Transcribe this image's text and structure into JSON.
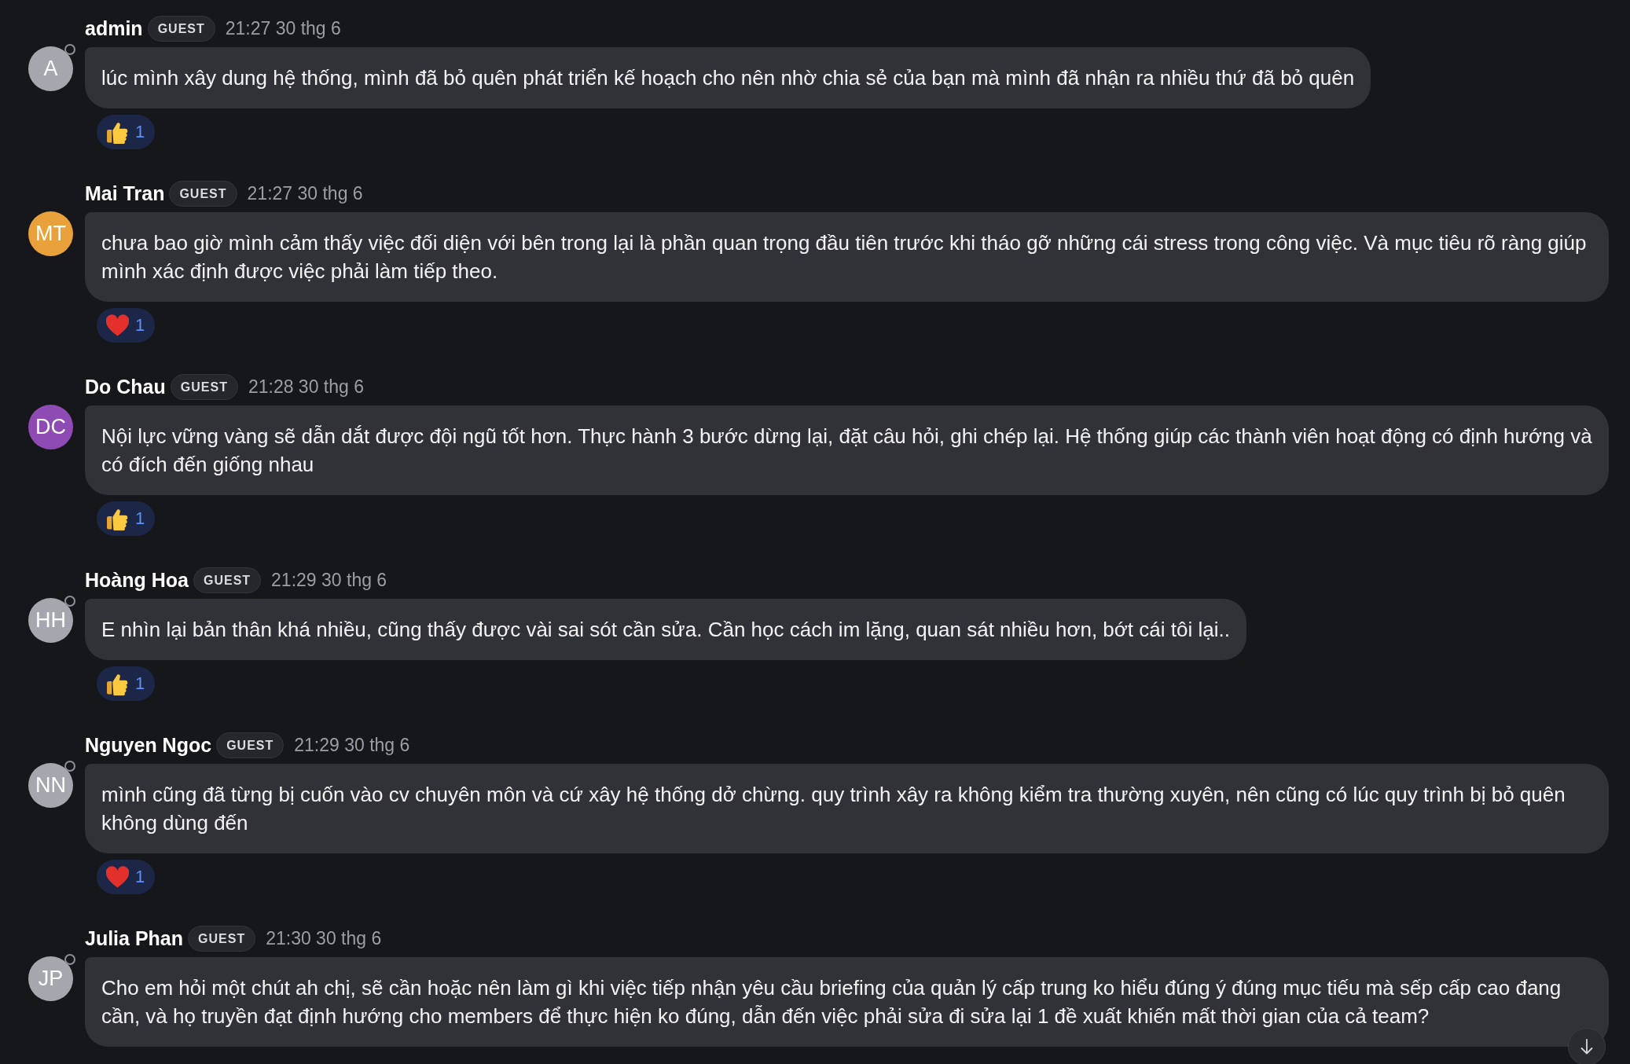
{
  "messages": [
    {
      "author": "admin",
      "badge": "GUEST",
      "time": "21:27 30 thg 6",
      "avatar": {
        "initials": "A",
        "color": "#a4a7ae",
        "status_ring": true
      },
      "text": "lúc mình xây dung hệ thống, mình đã bỏ quên phát triển kế hoạch cho nên nhờ chia sẻ của bạn mà mình đã nhận ra nhiều thứ đã bỏ quên",
      "reactions": [
        {
          "kind": "thumbs_up",
          "count": "1"
        }
      ]
    },
    {
      "author": "Mai Tran",
      "badge": "GUEST",
      "time": "21:27 30 thg 6",
      "avatar": {
        "initials": "MT",
        "color": "#e9a23b",
        "status_ring": false
      },
      "text": "chưa bao giờ mình cảm thấy việc đối diện với bên trong lại là phần quan trọng đầu tiên trước khi tháo gỡ những cái stress trong công việc. Và mục tiêu rõ ràng giúp mình xác định được việc phải làm tiếp theo.",
      "reactions": [
        {
          "kind": "heart",
          "count": "1"
        }
      ]
    },
    {
      "author": "Do Chau",
      "badge": "GUEST",
      "time": "21:28 30 thg 6",
      "avatar": {
        "initials": "DC",
        "color": "#8e4bb4",
        "status_ring": false
      },
      "text": "Nội lực vững vàng sẽ dẫn dắt được đội ngũ tốt hơn. Thực hành 3 bước dừng lại, đặt câu hỏi, ghi chép lại. Hệ thống giúp các thành viên hoạt động có định hướng và có đích đến giống nhau",
      "reactions": [
        {
          "kind": "thumbs_up",
          "count": "1"
        }
      ]
    },
    {
      "author": "Hoàng Hoa",
      "badge": "GUEST",
      "time": "21:29 30 thg 6",
      "avatar": {
        "initials": "HH",
        "color": "#a4a7ae",
        "status_ring": true
      },
      "text": "E nhìn lại bản thân khá nhiều, cũng thấy được vài sai sót cần sửa. Cần học cách im lặng, quan sát nhiều hơn, bớt cái tôi lại..",
      "reactions": [
        {
          "kind": "thumbs_up",
          "count": "1"
        }
      ]
    },
    {
      "author": "Nguyen Ngoc",
      "badge": "GUEST",
      "time": "21:29 30 thg 6",
      "avatar": {
        "initials": "NN",
        "color": "#a4a7ae",
        "status_ring": true
      },
      "text": "mình cũng đã từng bị cuốn vào cv chuyên môn và cứ xây hệ thống dở chừng. quy trình xây ra không kiểm tra thường xuyên, nên cũng có lúc quy trình bị bỏ quên không dùng đến",
      "reactions": [
        {
          "kind": "heart",
          "count": "1"
        }
      ]
    },
    {
      "author": "Julia Phan",
      "badge": "GUEST",
      "time": "21:30 30 thg 6",
      "avatar": {
        "initials": "JP",
        "color": "#a4a7ae",
        "status_ring": true
      },
      "text": "Cho em hỏi một chút ah chị, sẽ cần hoặc nên làm gì khi việc tiếp nhận yêu cầu briefing của quản lý cấp trung ko hiểu đúng ý đúng mục tiếu mà sếp cấp cao đang cần, và họ truyền đạt định hướng cho members để thực hiện ko đúng, dẫn đến việc phải sửa đi sửa lại 1 đề xuất khiến mất thời gian của cả team?"
    }
  ]
}
